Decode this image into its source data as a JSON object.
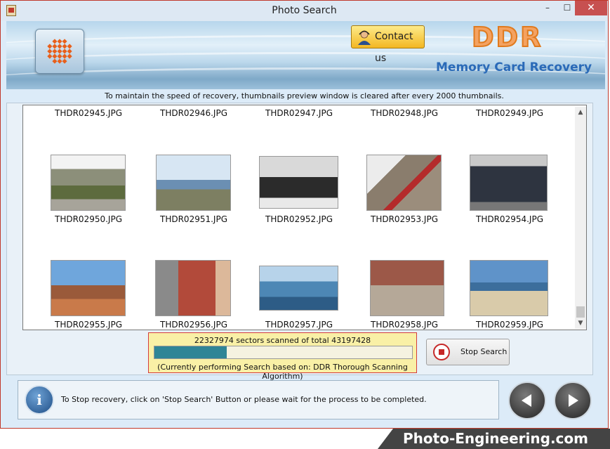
{
  "window": {
    "title": "Photo Search",
    "min": "–",
    "max": "☐",
    "close": "✕"
  },
  "banner": {
    "contact_label": "Contact us",
    "brand": "DDR",
    "product": "Memory Card Recovery"
  },
  "notice": "To maintain the speed of recovery, thumbnails preview window is cleared after every 2000 thumbnails.",
  "thumbnails": {
    "row1": [
      "THDR02945.JPG",
      "THDR02946.JPG",
      "THDR02947.JPG",
      "THDR02948.JPG",
      "THDR02949.JPG"
    ],
    "row2": [
      "THDR02950.JPG",
      "THDR02951.JPG",
      "THDR02952.JPG",
      "THDR02953.JPG",
      "THDR02954.JPG"
    ],
    "row3": [
      "THDR02955.JPG",
      "THDR02956.JPG",
      "THDR02957.JPG",
      "THDR02958.JPG",
      "THDR02959.JPG"
    ]
  },
  "scan": {
    "sectors_text": "22327974 sectors scanned of total 43197428",
    "sectors_scanned": 22327974,
    "sectors_total": 43197428,
    "progress_fraction": 0.28,
    "algorithm_text": "(Currently performing Search based on:  DDR Thorough Scanning Algorithm)"
  },
  "stop_button": {
    "label": "Stop Search"
  },
  "status_bar": {
    "message": "To Stop recovery, click on 'Stop Search' Button or please wait for the process to be completed."
  },
  "footer": {
    "brand": "Photo-Engineering.com"
  },
  "colors": {
    "accent": "#2a6ab8",
    "progress": "#2f8596",
    "brand_orange": "#f4a261"
  }
}
